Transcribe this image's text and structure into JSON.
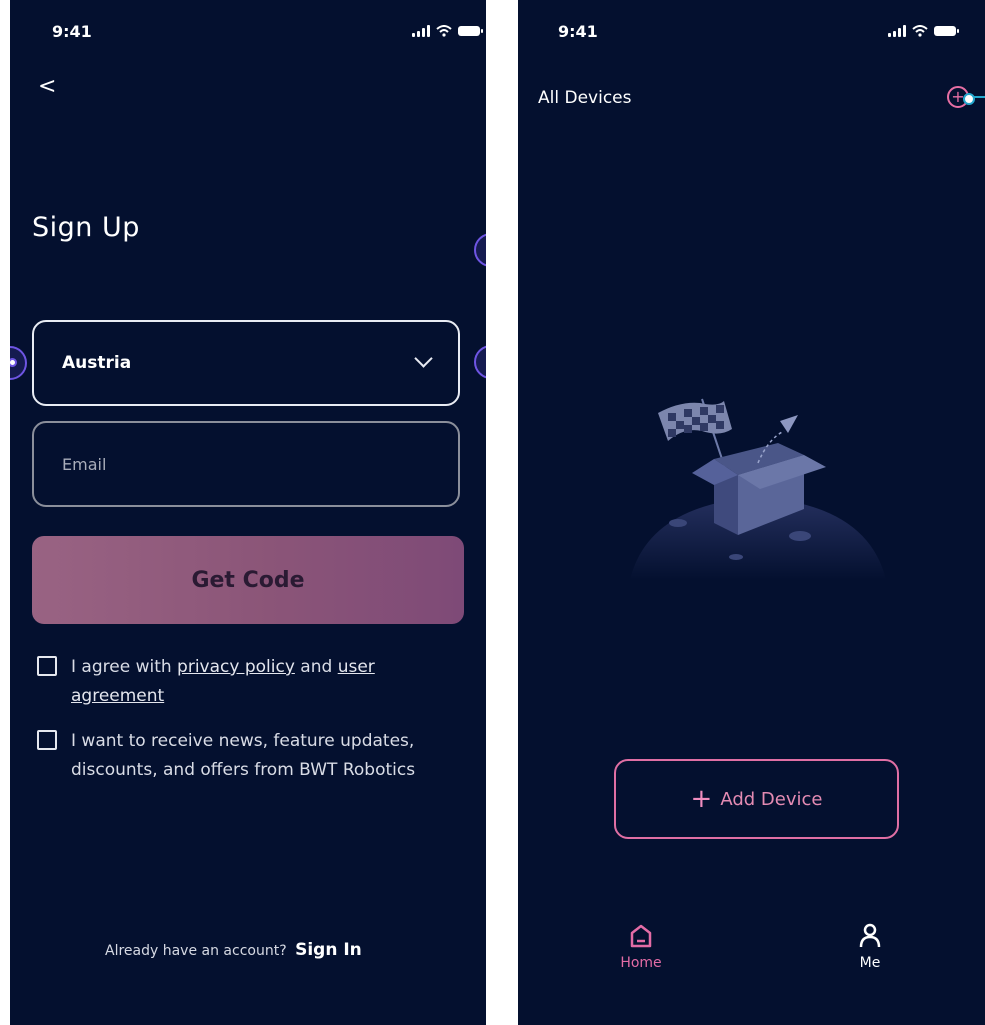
{
  "left_screen": {
    "status_time": "9:41",
    "back_icon": "<",
    "title": "Sign Up",
    "country": {
      "value": "Austria"
    },
    "email": {
      "placeholder": "Email"
    },
    "get_code_label": "Get Code",
    "agree": {
      "prefix": "I agree with ",
      "privacy_link": "privacy policy",
      "middle": " and ",
      "user_link": "user agreement"
    },
    "news_text": "I want to receive news, feature updates, discounts, and offers from BWT Robotics",
    "signin_prompt": "Already have an account?",
    "signin_label": "Sign In"
  },
  "right_screen": {
    "status_time": "9:41",
    "title": "All Devices",
    "add_device_label": "Add Device",
    "tabs": [
      {
        "label": "Home",
        "icon": "home-icon",
        "active": true
      },
      {
        "label": "Me",
        "icon": "person-icon",
        "active": false
      }
    ]
  },
  "colors": {
    "background": "#04102f",
    "accent_pink": "#e46ca6",
    "button_gradient_start": "#996383",
    "button_gradient_end": "#7e4a77",
    "handle_blue": "#6e55e3",
    "connector_cyan": "#24a7cd"
  }
}
